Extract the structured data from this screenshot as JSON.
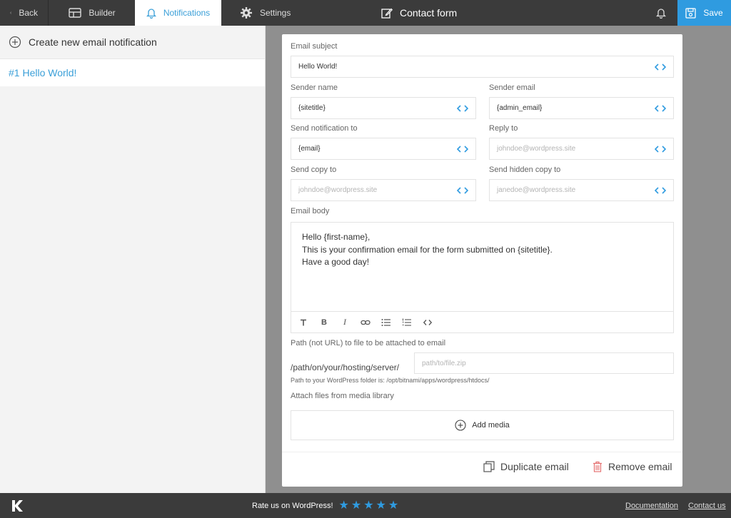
{
  "topbar": {
    "back_label": "Back",
    "builder_label": "Builder",
    "notifications_label": "Notifications",
    "settings_label": "Settings",
    "form_title": "Contact form",
    "save_label": "Save"
  },
  "sidebar": {
    "create_label": "Create new email notification",
    "items": [
      {
        "label": "#1 Hello World!"
      }
    ]
  },
  "form": {
    "email_subject": {
      "label": "Email subject",
      "value": "Hello World!"
    },
    "sender_name": {
      "label": "Sender name",
      "value": "{sitetitle}"
    },
    "sender_email": {
      "label": "Sender email",
      "value": "{admin_email}"
    },
    "send_to": {
      "label": "Send notification to",
      "value": "{email}"
    },
    "reply_to": {
      "label": "Reply to",
      "placeholder": "johndoe@wordpress.site"
    },
    "send_copy": {
      "label": "Send copy to",
      "placeholder": "johndoe@wordpress.site"
    },
    "send_hidden_copy": {
      "label": "Send hidden copy to",
      "placeholder": "janedoe@wordpress.site"
    },
    "email_body": {
      "label": "Email body",
      "lines": [
        "Hello {first-name},",
        "This is your confirmation email for the form submitted on {sitetitle}.",
        "Have a good day!"
      ]
    },
    "attachment": {
      "label": "Path (not URL) to file to be attached to email",
      "prefix": "/path/on/your/hosting/server/",
      "placeholder": "path/to/file.zip",
      "hint": "Path to your WordPress folder is: /opt/bitnami/apps/wordpress/htdocs/"
    },
    "media": {
      "label": "Attach files from media library",
      "add_label": "Add media"
    },
    "duplicate_label": "Duplicate email",
    "remove_label": "Remove email"
  },
  "footer": {
    "rate_label": "Rate us on WordPress!",
    "stars": 5,
    "documentation_label": "Documentation",
    "contact_label": "Contact us"
  },
  "colors": {
    "accent": "#2f9be0",
    "topbar_bg": "#3b3b3b",
    "remove_icon": "#e57373"
  }
}
